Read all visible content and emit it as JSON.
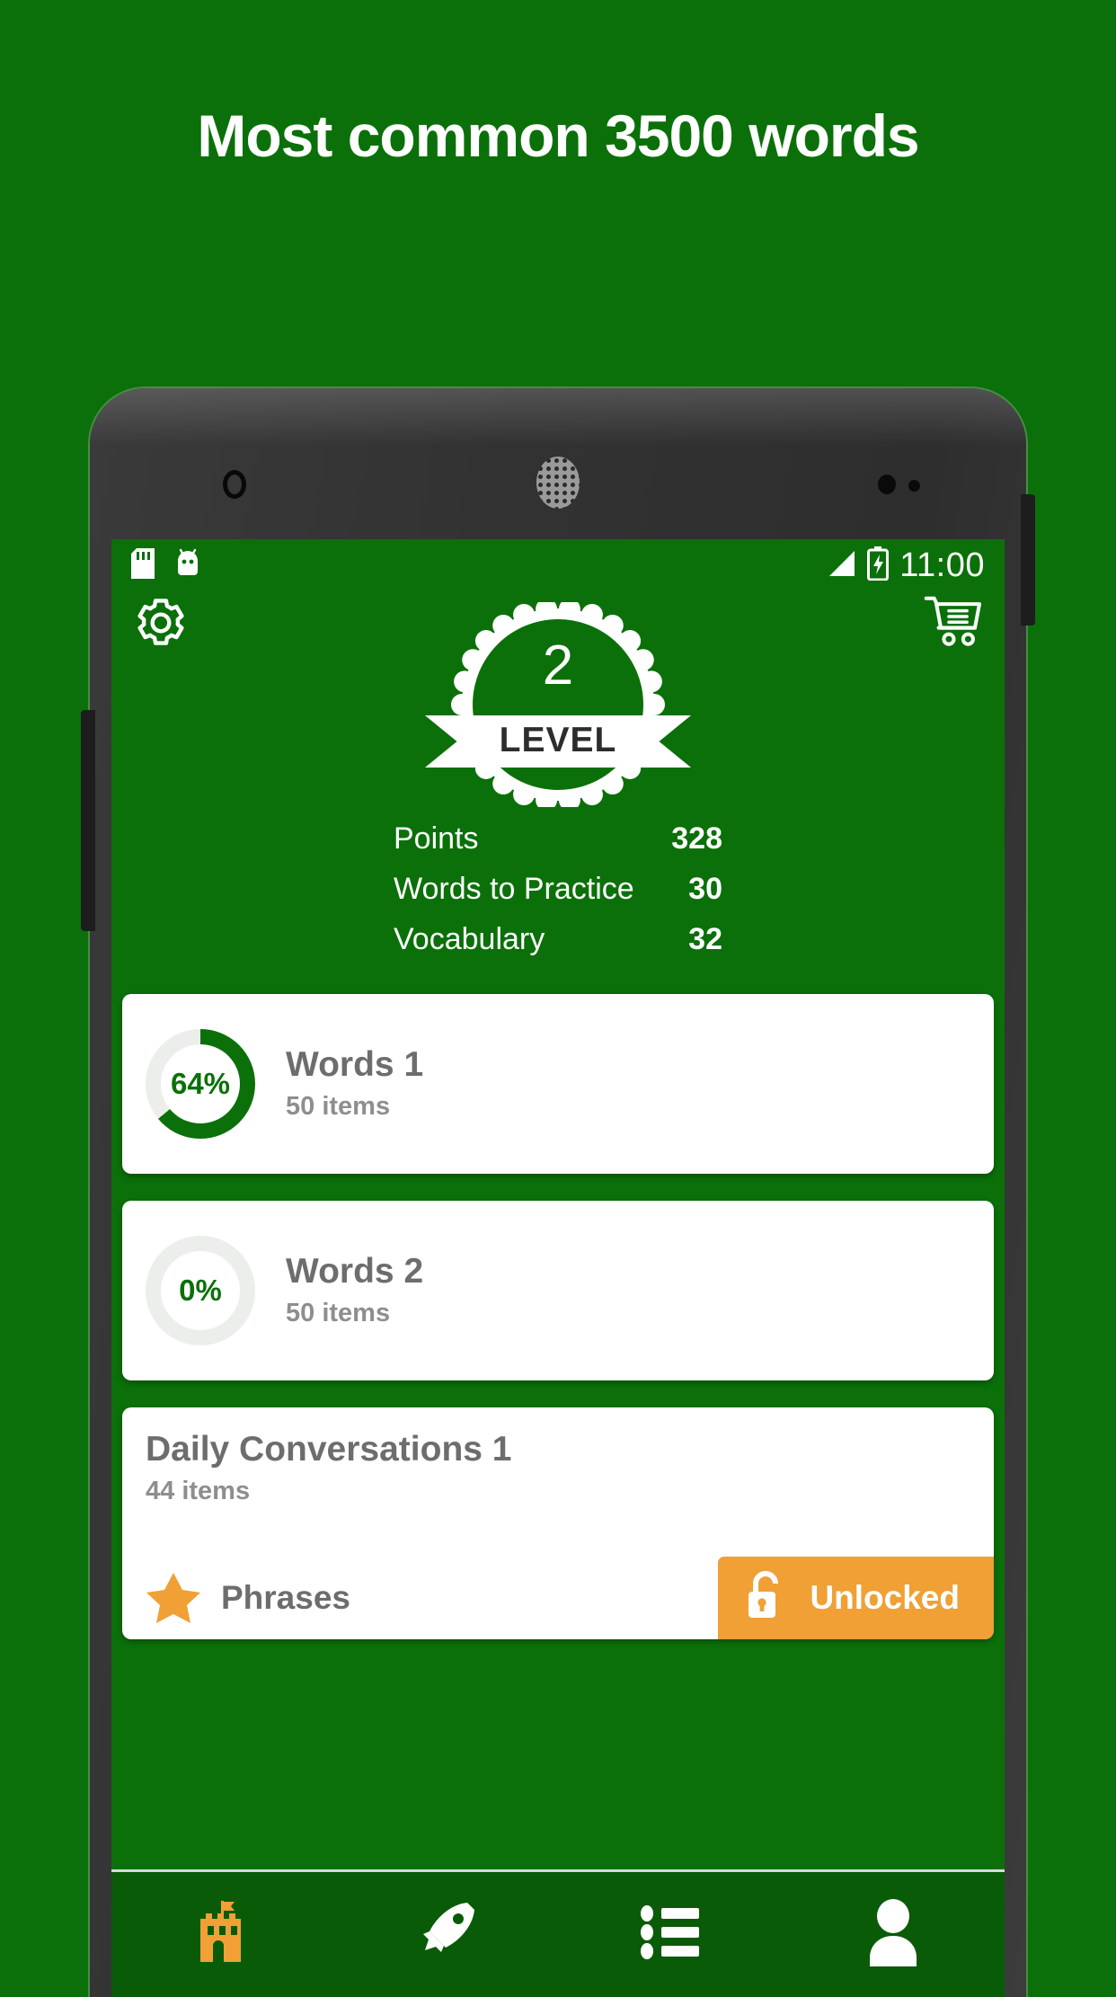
{
  "promo": {
    "title": "Most common 3500 words",
    "background_color": "#0b7009"
  },
  "status_bar": {
    "clock": "11:00",
    "icons": [
      "sd-card-icon",
      "android-icon",
      "signal-icon",
      "battery-charging-icon"
    ]
  },
  "app_bar": {
    "settings_icon": "gear-icon",
    "cart_icon": "shopping-cart-icon"
  },
  "level_badge": {
    "number": "2",
    "label": "LEVEL"
  },
  "stats": [
    {
      "label": "Points",
      "value": "328"
    },
    {
      "label": "Words to Practice",
      "value": "30"
    },
    {
      "label": "Vocabulary",
      "value": "32"
    }
  ],
  "cards": [
    {
      "title": "Words 1",
      "subtitle": "50 items",
      "percent_label": "64%",
      "percent": 64
    },
    {
      "title": "Words 2",
      "subtitle": "50 items",
      "percent_label": "0%",
      "percent": 0
    },
    {
      "title": "Daily Conversations 1",
      "subtitle": "44 items",
      "tag_label": "Phrases",
      "tag_icon": "star-icon",
      "unlock_label": "Unlocked",
      "unlock_icon": "open-padlock-icon",
      "unlock_color": "#f0a035"
    }
  ],
  "bottom_nav": [
    {
      "name": "castle",
      "active": true
    },
    {
      "name": "rocket",
      "active": false
    },
    {
      "name": "list",
      "active": false
    },
    {
      "name": "profile",
      "active": false
    }
  ],
  "colors": {
    "brand_green": "#0b7009",
    "dark_green": "#0a5b08",
    "orange": "#f0a035",
    "card_text": "#6d6d6d",
    "card_subtext": "#8e8e8e"
  }
}
